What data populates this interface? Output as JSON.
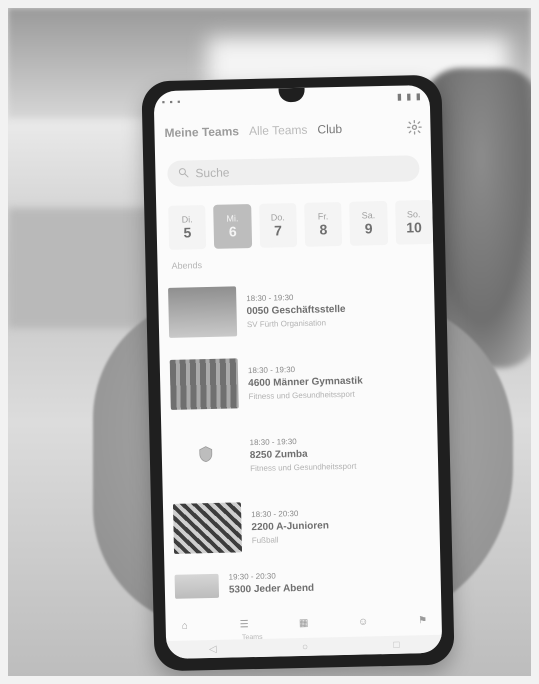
{
  "app": {
    "top_tabs": [
      {
        "label": "Meine Teams",
        "state": "active"
      },
      {
        "label": "Alle Teams",
        "state": "muted"
      },
      {
        "label": "Club",
        "state": "normal"
      }
    ],
    "search": {
      "placeholder": "Suche"
    }
  },
  "calendar": {
    "days": [
      {
        "dow": "Di.",
        "num": "5",
        "selected": false
      },
      {
        "dow": "Mi.",
        "num": "6",
        "selected": true
      },
      {
        "dow": "Do.",
        "num": "7",
        "selected": false
      },
      {
        "dow": "Fr.",
        "num": "8",
        "selected": false
      },
      {
        "dow": "Sa.",
        "num": "9",
        "selected": false
      },
      {
        "dow": "So.",
        "num": "10",
        "selected": false
      }
    ]
  },
  "section": {
    "label": "Abends"
  },
  "events": [
    {
      "time": "18:30 - 19:30",
      "title": "0050 Geschäftsstelle",
      "subtitle": "SV Fürth Organisation"
    },
    {
      "time": "18:30 - 19:30",
      "title": "4600 Männer Gymnastik",
      "subtitle": "Fitness und Gesundheitssport"
    },
    {
      "time": "18:30 - 19:30",
      "title": "8250 Zumba",
      "subtitle": "Fitness und Gesundheitssport"
    },
    {
      "time": "18:30 - 20:30",
      "title": "2200 A-Junioren",
      "subtitle": "Fußball"
    },
    {
      "time": "19:30 - 20:30",
      "title": "5300 Jeder Abend",
      "subtitle": ""
    }
  ],
  "bottom_nav": {
    "label": "Teams",
    "icons": [
      "home-icon",
      "teams-icon",
      "calendar-icon",
      "person-icon",
      "club-icon"
    ]
  },
  "colors": {
    "selected_day": "#bdbdbd",
    "screen_bg": "#fbfbfb",
    "phone_frame": "#1f1f1f"
  }
}
